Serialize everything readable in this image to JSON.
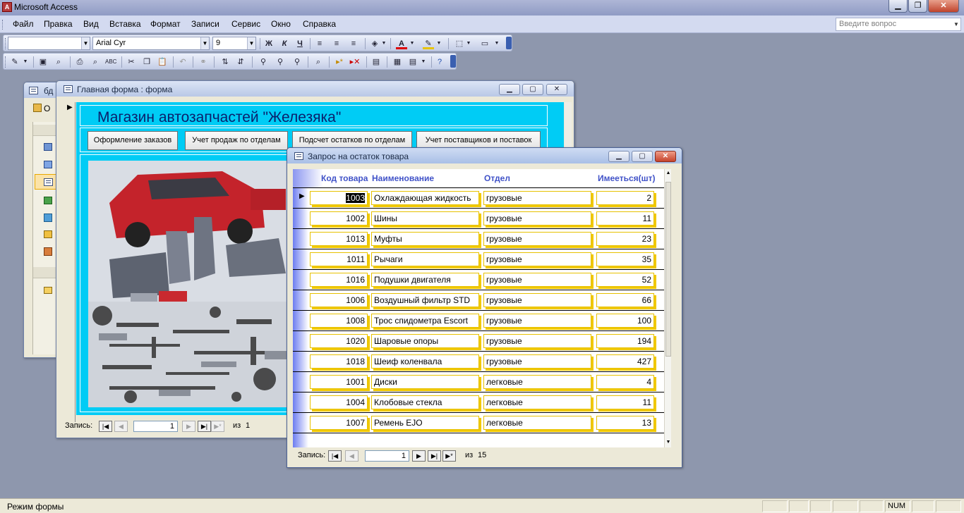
{
  "app": {
    "title": "Microsoft Access"
  },
  "menu": [
    "Файл",
    "Правка",
    "Вид",
    "Вставка",
    "Формат",
    "Записи",
    "Сервис",
    "Окно",
    "Справка"
  ],
  "help_box": {
    "placeholder": "Введите вопрос"
  },
  "format_toolbar": {
    "object_combo": "",
    "font": "Arial Cyr",
    "size": "9",
    "bold": "Ж",
    "italic": "К",
    "underline": "Ч"
  },
  "db_window": {
    "title": "бд",
    "open_label": "О"
  },
  "main_form": {
    "title": "Главная форма : форма",
    "header": "Магазин автозапчастей \"Железяка\"",
    "buttons": [
      "Оформление заказов",
      "Учет продаж по отделам",
      "Подсчет остатков по отделам",
      "Учет поставщиков  и поставок"
    ],
    "nav": {
      "label": "Запись:",
      "current": "1",
      "of_label": "из",
      "total": "1"
    }
  },
  "query_window": {
    "title": "Запрос на остаток товара",
    "columns": [
      "Код товара",
      "Наименование",
      "Отдел",
      "Имееться(шт)"
    ],
    "rows": [
      {
        "code": "1003",
        "name": "Охлаждающая жидкость",
        "dept": "грузовые",
        "qty": "2"
      },
      {
        "code": "1002",
        "name": "Шины",
        "dept": "грузовые",
        "qty": "11"
      },
      {
        "code": "1013",
        "name": "Муфты",
        "dept": "грузовые",
        "qty": "23"
      },
      {
        "code": "1011",
        "name": "Рычаги",
        "dept": "грузовые",
        "qty": "35"
      },
      {
        "code": "1016",
        "name": "Подушки двигателя",
        "dept": "грузовые",
        "qty": "52"
      },
      {
        "code": "1006",
        "name": "Воздушный фильтр STD",
        "dept": "грузовые",
        "qty": "66"
      },
      {
        "code": "1008",
        "name": "Трос спидометра Escort",
        "dept": "грузовые",
        "qty": "100"
      },
      {
        "code": "1020",
        "name": "Шаровые опоры",
        "dept": "грузовые",
        "qty": "194"
      },
      {
        "code": "1018",
        "name": "Шеиф коленвала",
        "dept": "грузовые",
        "qty": "427"
      },
      {
        "code": "1001",
        "name": "Диски",
        "dept": "легковые",
        "qty": "4"
      },
      {
        "code": "1004",
        "name": "Клобовые стекла",
        "dept": "легковые",
        "qty": "11"
      },
      {
        "code": "1007",
        "name": "Ремень EJO",
        "dept": "легковые",
        "qty": "13"
      }
    ],
    "nav": {
      "label": "Запись:",
      "current": "1",
      "of_label": "из",
      "total": "15"
    }
  },
  "status": {
    "mode": "Режим формы",
    "num": "NUM"
  },
  "colors": {
    "form_bg": "#00ccf5",
    "header_text": "#0b1f6b",
    "cell_border": "#f0c800"
  }
}
